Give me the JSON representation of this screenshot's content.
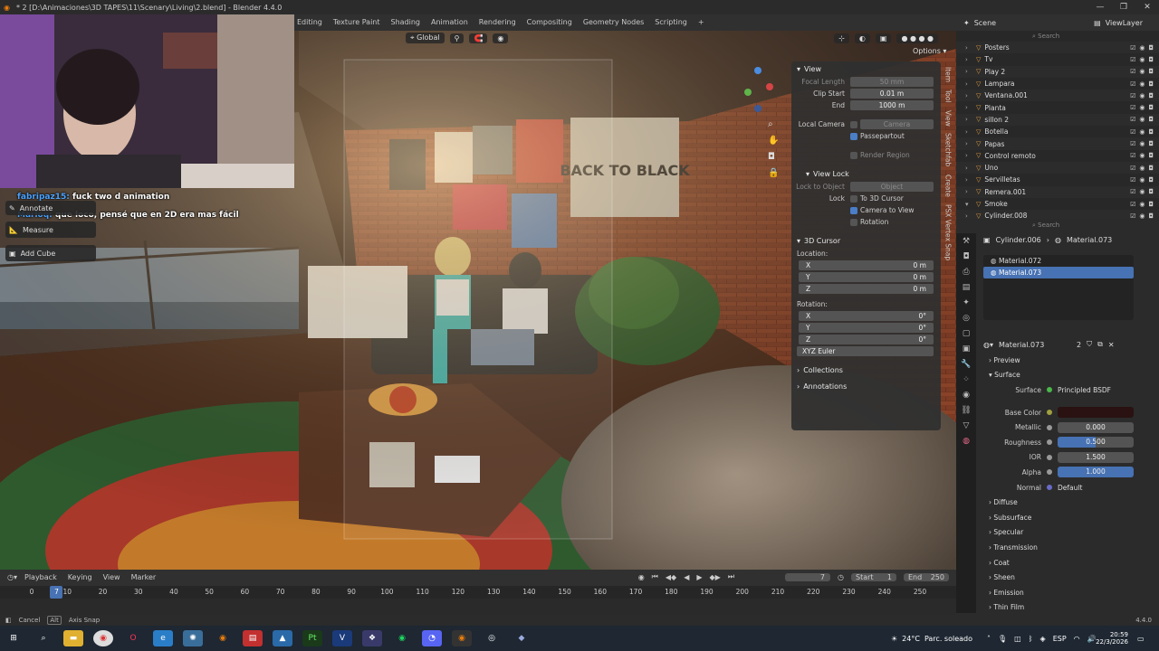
{
  "window": {
    "title": "* 2 [D:\\Animaciones\\3D TAPES\\11\\Scenary\\Living\\2.blend] - Blender 4.4.0",
    "controls": [
      "—",
      "❐",
      "✕"
    ]
  },
  "workspaces": [
    "Editing",
    "Texture Paint",
    "Shading",
    "Animation",
    "Rendering",
    "Compositing",
    "Geometry Nodes",
    "Scripting",
    "+"
  ],
  "viewport_header": {
    "orientation": "Global",
    "options": "Options"
  },
  "chat": [
    {
      "user": "fabripaz15:",
      "text": "fuck two d animation"
    },
    {
      "user": "Marloq:",
      "text": "que loco, pensé que en 2D era mas fácil"
    }
  ],
  "tools": [
    "Annotate",
    "Measure",
    "Add Cube"
  ],
  "npanel": {
    "tabs": [
      "Item",
      "Tool",
      "View",
      "Sketchfab",
      "Create",
      "PSX Vertex Snap"
    ],
    "view": {
      "header": "View",
      "focal_length_label": "Focal Length",
      "focal_length": "50 mm",
      "clip_start_label": "Clip Start",
      "clip_start": "0.01 m",
      "end_label": "End",
      "end": "1000 m",
      "local_camera_label": "Local Camera",
      "camera": "Camera",
      "passepartout": "Passepartout",
      "render_region": "Render Region"
    },
    "view_lock": {
      "header": "View Lock",
      "lock_to_object_label": "Lock to Object",
      "object": "Object",
      "lock_label": "Lock",
      "to_3d_cursor": "To 3D Cursor",
      "camera_to_view": "Camera to View",
      "rotation": "Rotation"
    },
    "cursor": {
      "header": "3D Cursor",
      "location_label": "Location:",
      "rotation_label": "Rotation:",
      "loc": [
        {
          "axis": "X",
          "val": "0 m"
        },
        {
          "axis": "Y",
          "val": "0 m"
        },
        {
          "axis": "Z",
          "val": "0 m"
        }
      ],
      "rot": [
        {
          "axis": "X",
          "val": "0°"
        },
        {
          "axis": "Y",
          "val": "0°"
        },
        {
          "axis": "Z",
          "val": "0°"
        }
      ],
      "mode": "XYZ Euler"
    },
    "collections": "Collections",
    "annotations": "Annotations"
  },
  "outliner": {
    "scene": "Scene",
    "view_layer": "ViewLayer",
    "search_placeholder": "Search",
    "items": [
      "Posters",
      "Tv",
      "Play 2",
      "Lampara",
      "Ventana.001",
      "Planta",
      "sillon 2",
      "Botella",
      "Papas",
      "Control remoto",
      "Uno",
      "Servilletas",
      "Remera.001",
      "Smoke",
      "Cylinder.008"
    ]
  },
  "properties": {
    "search_placeholder": "Search",
    "object": "Cylinder.006",
    "material": "Material.073",
    "slots": [
      "Material.072",
      "Material.073"
    ],
    "mat_name": "Material.073",
    "users": "2",
    "preview": "Preview",
    "surface": "Surface",
    "surface_label": "Surface",
    "surface_shader": "Principled BSDF",
    "base_color_label": "Base Color",
    "metallic_label": "Metallic",
    "metallic": "0.000",
    "roughness_label": "Roughness",
    "roughness": "0.500",
    "ior_label": "IOR",
    "ior": "1.500",
    "alpha_label": "Alpha",
    "alpha": "1.000",
    "normal_label": "Normal",
    "normal": "Default",
    "subpanels": [
      "Diffuse",
      "Subsurface",
      "Specular",
      "Transmission",
      "Coat",
      "Sheen",
      "Emission",
      "Thin Film"
    ]
  },
  "timeline": {
    "menus": [
      "Playback",
      "Keying",
      "View",
      "Marker"
    ],
    "current_frame": "7",
    "start_label": "Start",
    "start": "1",
    "end_label": "End",
    "end": "250",
    "ticks": [
      "0",
      "10",
      "20",
      "30",
      "40",
      "50",
      "60",
      "70",
      "80",
      "90",
      "100",
      "110",
      "120",
      "130",
      "140",
      "150",
      "160",
      "170",
      "180",
      "190",
      "200",
      "210",
      "220",
      "230",
      "240",
      "250"
    ],
    "playhead": "7"
  },
  "status": {
    "cancel": "Cancel",
    "alt": "Alt",
    "axis_snap": "Axis Snap",
    "version": "4.4.0"
  },
  "taskbar": {
    "weather": "24°C",
    "weather_desc": "Parc. soleado",
    "lang": "ESP",
    "time": "20:59",
    "date": "22/3/2026"
  },
  "colors": {
    "accent": "#4772b3",
    "brick": "#7a3a22",
    "rug_green": "#2e5a2e"
  }
}
